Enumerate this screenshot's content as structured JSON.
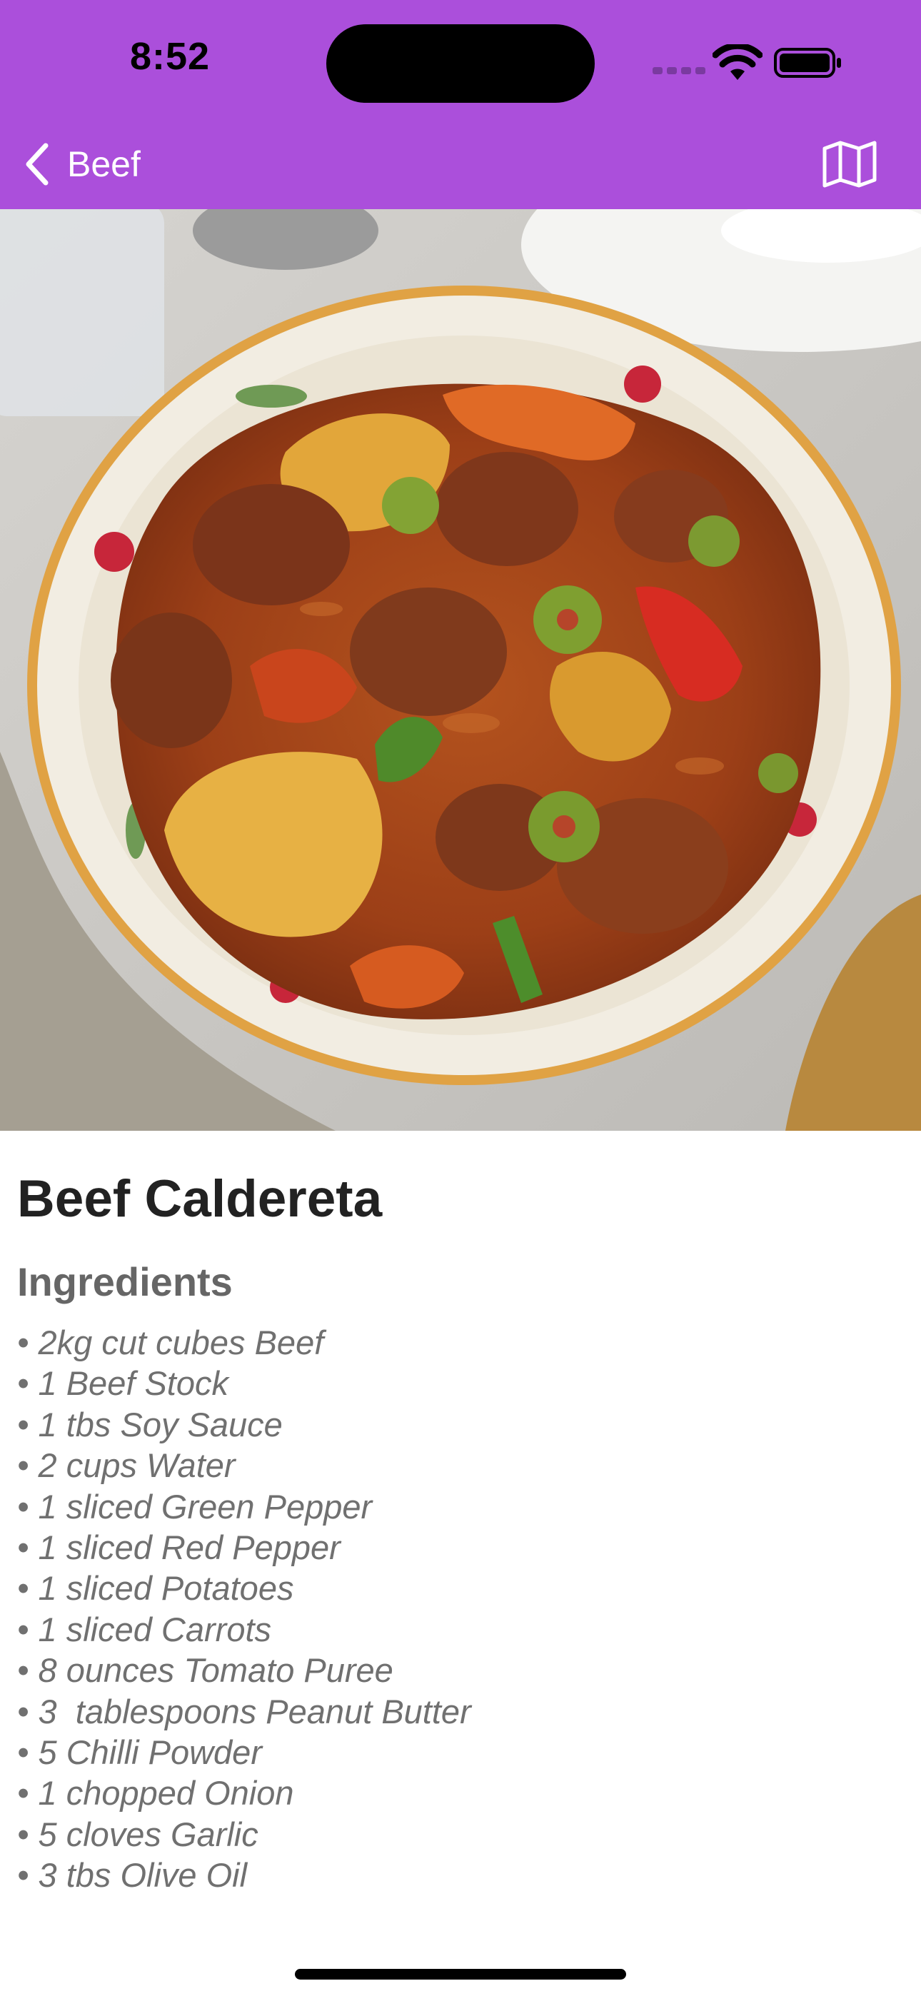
{
  "status_bar": {
    "time": "8:52"
  },
  "nav": {
    "back_label": "Beef",
    "map_icon": "map-icon"
  },
  "hero": {
    "alt": "Beef Caldereta in a bowl"
  },
  "recipe": {
    "title": "Beef Caldereta",
    "ingredients_heading": "Ingredients",
    "ingredients": [
      "• 2kg cut cubes Beef",
      "• 1 Beef Stock",
      "• 1 tbs Soy Sauce",
      "• 2 cups Water",
      "• 1 sliced Green Pepper",
      "• 1 sliced Red Pepper",
      "• 1 sliced Potatoes",
      "• 1 sliced Carrots",
      "• 8 ounces Tomato Puree",
      "• 3  tablespoons Peanut Butter",
      "• 5 Chilli Powder",
      "• 1 chopped Onion",
      "• 5 cloves Garlic",
      "• 3 tbs Olive Oil"
    ]
  },
  "colors": {
    "nav_background": "#ab4fdb"
  }
}
